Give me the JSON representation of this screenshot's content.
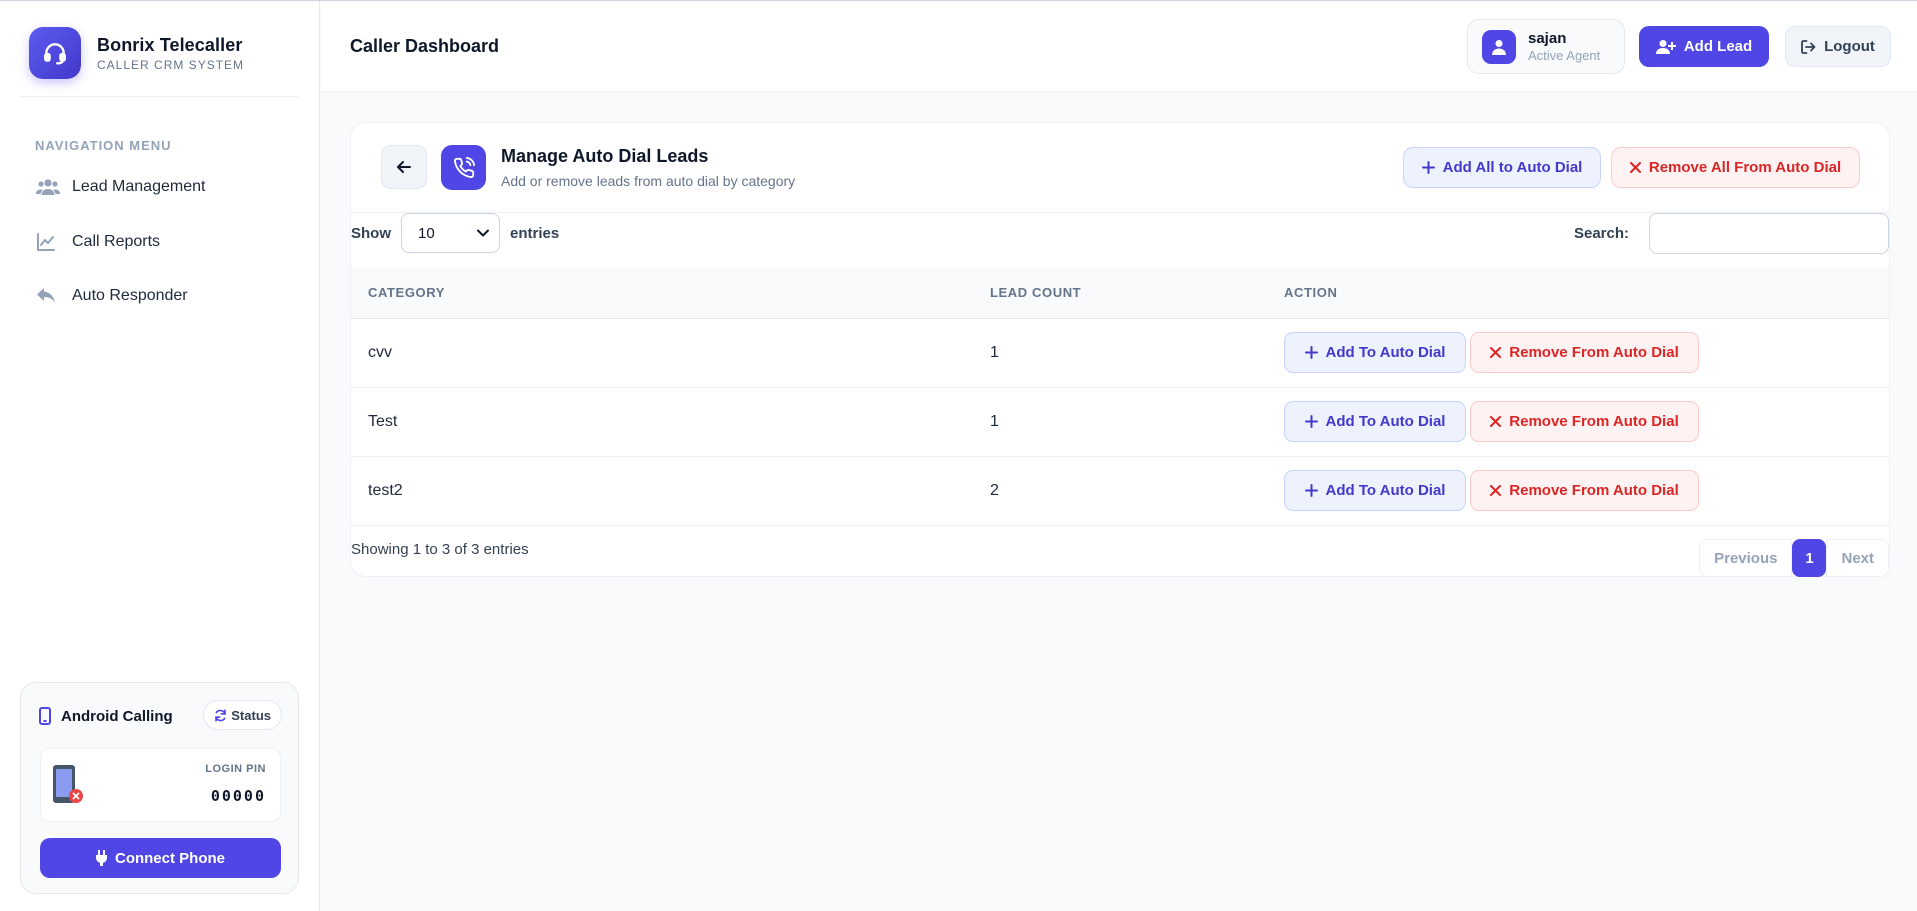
{
  "brand": {
    "name": "Bonrix Telecaller",
    "subtitle": "CALLER CRM SYSTEM",
    "logo_icon": "headset-icon"
  },
  "nav": {
    "title": "NAVIGATION MENU",
    "items": [
      {
        "label": "Lead Management",
        "icon": "users-icon"
      },
      {
        "label": "Call Reports",
        "icon": "line-chart-icon"
      },
      {
        "label": "Auto Responder",
        "icon": "reply-icon"
      }
    ]
  },
  "android": {
    "title": "Android Calling",
    "status_label": "Status",
    "pin_label": "LOGIN PIN",
    "pin_value": "00000",
    "connect_label": "Connect Phone"
  },
  "header": {
    "page_title": "Caller Dashboard",
    "user_name": "sajan",
    "user_role": "Active Agent",
    "add_lead_label": "Add Lead",
    "logout_label": "Logout"
  },
  "card": {
    "title": "Manage Auto Dial Leads",
    "subtitle": "Add or remove leads from auto dial by category",
    "add_all_label": "Add All to Auto Dial",
    "remove_all_label": "Remove All From Auto Dial"
  },
  "table_controls": {
    "show_label": "Show",
    "entries_value": "10",
    "entries_label": "entries",
    "search_label": "Search:",
    "search_value": ""
  },
  "table": {
    "columns": [
      "CATEGORY",
      "LEAD COUNT",
      "ACTION"
    ],
    "add_label": "Add To Auto Dial",
    "remove_label": "Remove From Auto Dial",
    "rows": [
      {
        "category": "cvv",
        "count": "1"
      },
      {
        "category": "Test",
        "count": "1"
      },
      {
        "category": "test2",
        "count": "2"
      }
    ]
  },
  "footer": {
    "info": "Showing 1 to 3 of 3 entries",
    "previous": "Previous",
    "current_page": "1",
    "next": "Next"
  },
  "colors": {
    "accent": "#4f46e5",
    "danger": "#dc2626"
  }
}
